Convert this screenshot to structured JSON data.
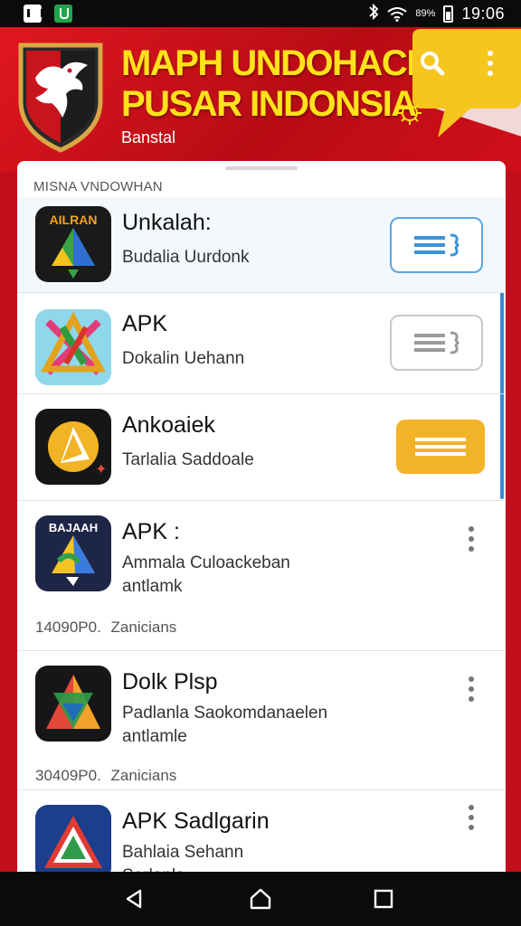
{
  "status_bar": {
    "battery_percent": "89%",
    "time": "19:06",
    "icons": [
      "mail-icon",
      "app-notification-icon",
      "bluetooth-icon",
      "wifi-icon",
      "battery-icon"
    ]
  },
  "header": {
    "title_line1": "MAPH UNDOHACI",
    "title_line2": "PUSAR INDONSIA",
    "subtitle": "Banstal",
    "colors": {
      "background": "#d0101a",
      "title": "#ffe21a",
      "bubble": "#f6c51e"
    }
  },
  "list": {
    "section_label": "MISNA VNDOWHAN",
    "items": [
      {
        "icon_label": "AILRAN",
        "title": "Unkalah:",
        "subtitle": "Budalia Uurdonk",
        "action": "list-button"
      },
      {
        "title": "APK",
        "subtitle": "Dokalin Uehann",
        "action": "list-button"
      },
      {
        "title": "Ankoaiek",
        "subtitle": "Tarlalia Saddoale",
        "action": "list-button"
      },
      {
        "icon_label": "BAJAAH",
        "title": "APK :",
        "subtitle": "Ammala Culoackeban",
        "subtitle2": "antlamk",
        "meta_left": "14090P0.",
        "meta_right": "Zanicians",
        "action": "more-menu"
      },
      {
        "title": "Dolk Plsp",
        "subtitle": "Padlanla Saokomdanaelen",
        "subtitle2": "antlamle",
        "meta_left": "30409P0.",
        "meta_right": "Zanicians",
        "action": "more-menu"
      },
      {
        "title": "APK Sadlgarin",
        "subtitle": "Bahlaia Sehann",
        "subtitle2": "Serlanla",
        "action": "more-menu"
      }
    ]
  },
  "navbar": {
    "icons": [
      "back-triangle-icon",
      "home-icon",
      "recents-square-icon"
    ]
  }
}
